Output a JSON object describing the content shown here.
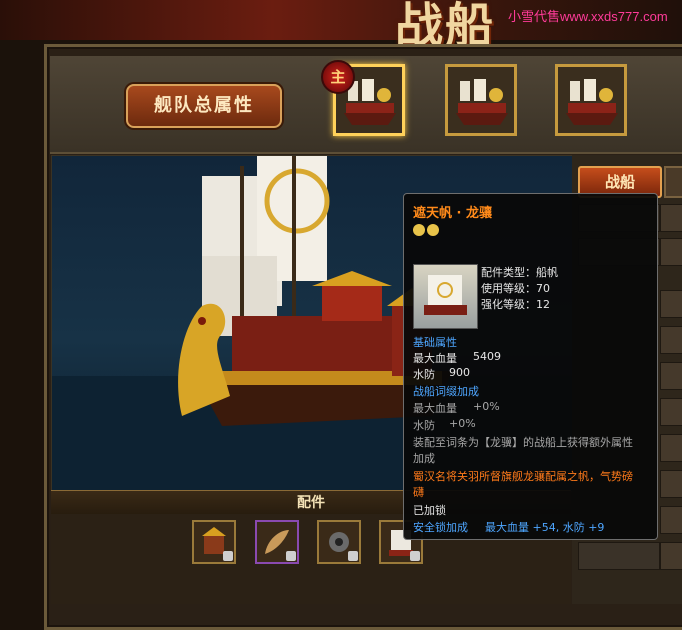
{
  "header": {
    "title_art": "战船",
    "watermark": "小雪代售www.xxds777.com"
  },
  "fleet": {
    "total_attr_button": "舰队总属性",
    "main_badge": "主",
    "slots": [
      {
        "name": "ship-slot-1",
        "active": true
      },
      {
        "name": "ship-slot-2",
        "active": false
      },
      {
        "name": "ship-slot-3",
        "active": false
      }
    ]
  },
  "right_panel": {
    "tab_label": "战船"
  },
  "parts": {
    "title": "配件",
    "items": [
      "part-1",
      "part-2",
      "part-3",
      "part-4"
    ]
  },
  "tooltip": {
    "name": "遮天帆 · 龙骧",
    "type": "配件类型：船帆",
    "use_level": "使用等级：70",
    "enhance_level": "强化等级：12",
    "basic_header": "基础属性",
    "max_hp_label": "最大血量",
    "max_hp_value": "5409",
    "water_def_label": "水防",
    "water_def_value": "900",
    "affix_header": "战船词缀加成",
    "affix_hp_label": "最大血量",
    "affix_hp_value": "+0%",
    "affix_water_label": "水防",
    "affix_water_value": "+0%",
    "note_line1": "装配至词条为【龙骥】的战船上获得额外属性",
    "note_line2": "加成",
    "lore_line1": "蜀汉名将关羽所督旗舰龙骧配属之帆，气势磅",
    "lore_line2": "礴",
    "locked": "已加锁",
    "lock_bonus_label": "安全锁加成",
    "lock_bonus_value": "最大血量 +54, 水防 +9"
  }
}
